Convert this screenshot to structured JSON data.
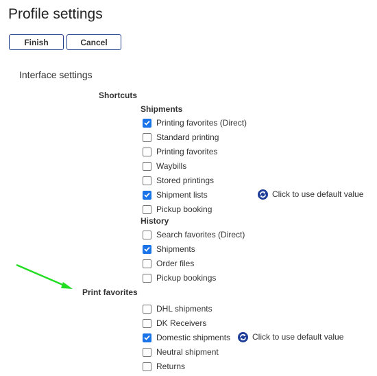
{
  "page": {
    "title": "Profile settings"
  },
  "buttons": {
    "finish": "Finish",
    "cancel": "Cancel"
  },
  "section_title": "Interface settings",
  "shortcuts": {
    "heading": "Shortcuts",
    "shipments": {
      "heading": "Shipments",
      "items": [
        {
          "label": "Printing favorites (Direct)",
          "checked": true
        },
        {
          "label": "Standard printing",
          "checked": false
        },
        {
          "label": "Printing favorites",
          "checked": false
        },
        {
          "label": "Waybills",
          "checked": false
        },
        {
          "label": "Stored printings",
          "checked": false
        },
        {
          "label": "Shipment lists",
          "checked": true
        },
        {
          "label": "Pickup booking",
          "checked": false
        }
      ]
    },
    "history": {
      "heading": "History",
      "items": [
        {
          "label": "Search favorites (Direct)",
          "checked": false
        },
        {
          "label": "Shipments",
          "checked": true
        },
        {
          "label": "Order files",
          "checked": false
        },
        {
          "label": "Pickup bookings",
          "checked": false
        }
      ]
    }
  },
  "print_favorites": {
    "heading": "Print favorites",
    "items": [
      {
        "label": "DHL shipments",
        "checked": false
      },
      {
        "label": "DK Receivers",
        "checked": false
      },
      {
        "label": "Domestic shipments",
        "checked": true
      },
      {
        "label": "Neutral shipment",
        "checked": false
      },
      {
        "label": "Returns",
        "checked": false
      }
    ]
  },
  "default_hint": {
    "text": "Click to use default value",
    "icon": "reset-default-icon"
  },
  "annotation": {
    "icon": "green-arrow-icon",
    "color": "#22dd22"
  },
  "colors": {
    "accent": "#1a73e8",
    "button_border": "#1f3d8a",
    "default_icon": "#1d3d99"
  }
}
